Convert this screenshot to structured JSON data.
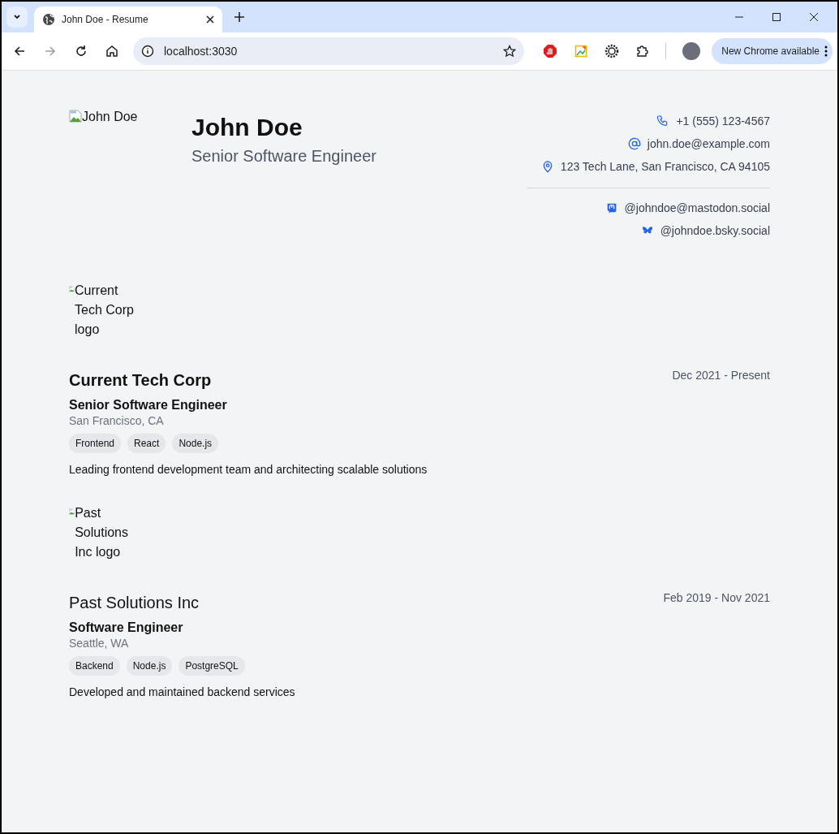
{
  "browser": {
    "tab_title": "John Doe - Resume",
    "url": "localhost:3030",
    "update_button": "New Chrome available"
  },
  "header": {
    "photo_alt": "John Doe",
    "name": "John Doe",
    "title": "Senior Software Engineer",
    "contacts": [
      {
        "kind": "phone",
        "text": "+1 (555) 123-4567"
      },
      {
        "kind": "email",
        "text": "john.doe@example.com"
      },
      {
        "kind": "location",
        "text": "123 Tech Lane, San Francisco, CA 94105"
      }
    ],
    "socials": [
      {
        "kind": "mastodon",
        "text": "@johndoe@mastodon.social"
      },
      {
        "kind": "bluesky",
        "text": "@johndoe.bsky.social"
      }
    ]
  },
  "experience": [
    {
      "logo_alt": "Current Tech Corp logo",
      "company": "Current Tech Corp",
      "bold": true,
      "dates": "Dec 2021 - Present",
      "role": "Senior Software Engineer",
      "location": "San Francisco, CA",
      "tags": [
        "Frontend",
        "React",
        "Node.js"
      ],
      "description": "Leading frontend development team and architecting scalable solutions"
    },
    {
      "logo_alt": "Past Solutions Inc logo",
      "company": "Past Solutions Inc",
      "bold": false,
      "dates": "Feb 2019 - Nov 2021",
      "role": "Software Engineer",
      "location": "Seattle, WA",
      "tags": [
        "Backend",
        "Node.js",
        "PostgreSQL"
      ],
      "description": "Developed and maintained backend services"
    }
  ]
}
